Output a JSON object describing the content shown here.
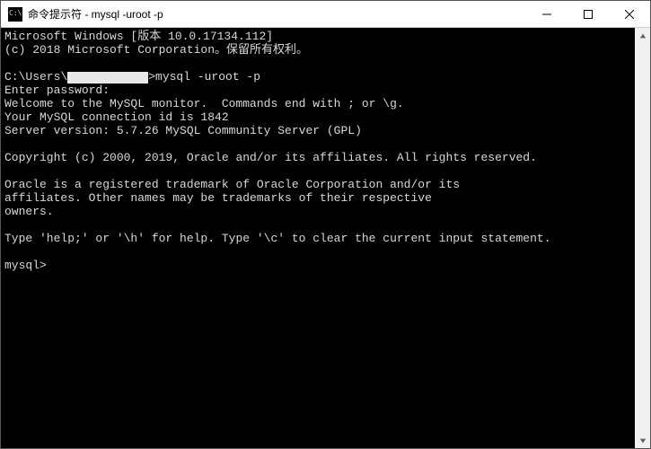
{
  "titlebar": {
    "title": "命令提示符 - mysql  -uroot -p"
  },
  "terminal": {
    "line1": "Microsoft Windows [版本 10.0.17134.112]",
    "line2": "(c) 2018 Microsoft Corporation。保留所有权利。",
    "blank1": "",
    "prompt_prefix": "C:\\Users\\",
    "prompt_suffix": ">mysql -uroot -p",
    "line4": "Enter password:",
    "line5": "Welcome to the MySQL monitor.  Commands end with ; or \\g.",
    "line6": "Your MySQL connection id is 1842",
    "line7": "Server version: 5.7.26 MySQL Community Server (GPL)",
    "blank2": "",
    "line8": "Copyright (c) 2000, 2019, Oracle and/or its affiliates. All rights reserved.",
    "blank3": "",
    "line9": "Oracle is a registered trademark of Oracle Corporation and/or its",
    "line10": "affiliates. Other names may be trademarks of their respective",
    "line11": "owners.",
    "blank4": "",
    "line12": "Type 'help;' or '\\h' for help. Type '\\c' to clear the current input statement.",
    "blank5": "",
    "line13": "mysql>"
  }
}
